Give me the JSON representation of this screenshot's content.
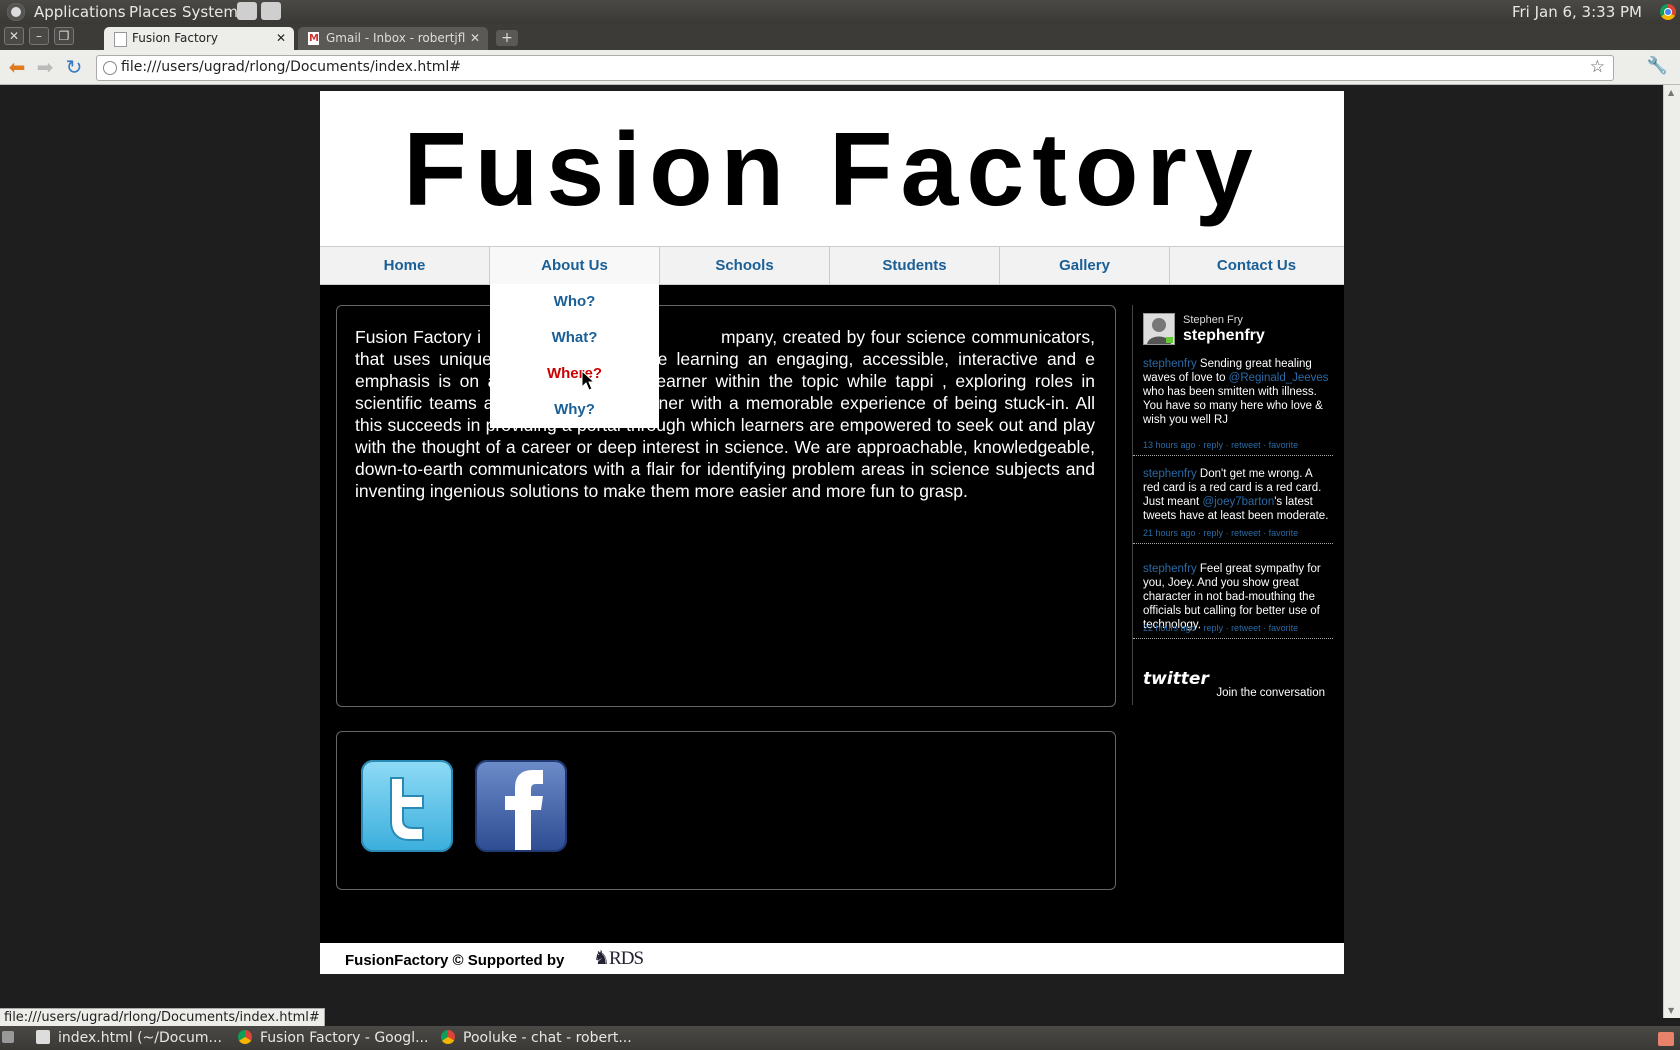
{
  "panel": {
    "menus": [
      "Applications",
      "Places",
      "System"
    ],
    "clock": "Fri Jan 6,  3:33 PM"
  },
  "browser": {
    "tabs": [
      {
        "title": "Fusion Factory",
        "active": true
      },
      {
        "title": "Gmail - Inbox - robertjflong",
        "active": false
      }
    ],
    "url": "file:///users/ugrad/rlong/Documents/index.html#",
    "status_url": "file:///users/ugrad/rlong/Documents/index.html#"
  },
  "site": {
    "title": "Fusion Factory",
    "nav": [
      "Home",
      "About Us",
      "Schools",
      "Students",
      "Gallery",
      "Contact Us"
    ],
    "dropdown": [
      "Who?",
      "What?",
      "Where?",
      "Why?"
    ],
    "dropdown_hover_index": 2,
    "intro_before": "Fusion Factory i",
    "intro_after": "mpany, created by four science communicators, that uses uniquely d to make science learning an engaging, accessible, interactive and e emphasis is on accommodating the learner within the topic while tappi , exploring roles in scientific teams and providing the learner with a memorable experience of being stuck-in. All this succeeds in providing a portal through which learners are empowered to seek out and play with the thought of a career or deep interest in science. We are approachable, knowledgeable, down-to-earth communicators with a flair for identifying problem areas in science subjects and inventing ingenious solutions to make them more easier and more fun to grasp.",
    "footer": "FusionFactory © Supported by",
    "sponsor": "RDS"
  },
  "twitter": {
    "real_name": "Stephen Fry",
    "handle": "stephenfry",
    "tweets": [
      {
        "user": "stephenfry",
        "pre": " Sending great healing waves of love to ",
        "mention": "@Reginald_Jeeves",
        "post": " who has been smitten with illness. You have so many here who love & wish you well RJ",
        "time": "13 hours ago"
      },
      {
        "user": "stephenfry",
        "pre": " Don't get me wrong. A red card is a red card is a red card. Just meant ",
        "mention": "@joey7barton",
        "post": "'s latest tweets have at least been moderate.",
        "time": "21 hours ago"
      },
      {
        "user": "stephenfry",
        "pre": " Feel great sympathy for you, Joey. And you show great character in not bad-mouthing the officials but calling for better use of technology.",
        "mention": "",
        "post": "",
        "time": "22 hours ago"
      }
    ],
    "actions": [
      "reply",
      "retweet",
      "favorite"
    ],
    "logo": "twitter",
    "join": "Join the conversation"
  },
  "taskbar": [
    {
      "label": "index.html (~/Docum...",
      "icon": "text-editor-icon"
    },
    {
      "label": "Fusion Factory - Googl...",
      "icon": "chrome-icon"
    },
    {
      "label": "Pooluke - chat - robert...",
      "icon": "chrome-icon"
    }
  ],
  "colors": {
    "nav_link": "#1a5f96",
    "dropdown_hover": "#cc0000",
    "page_bg": "#000000",
    "tweet_link": "#2a6aa5"
  }
}
